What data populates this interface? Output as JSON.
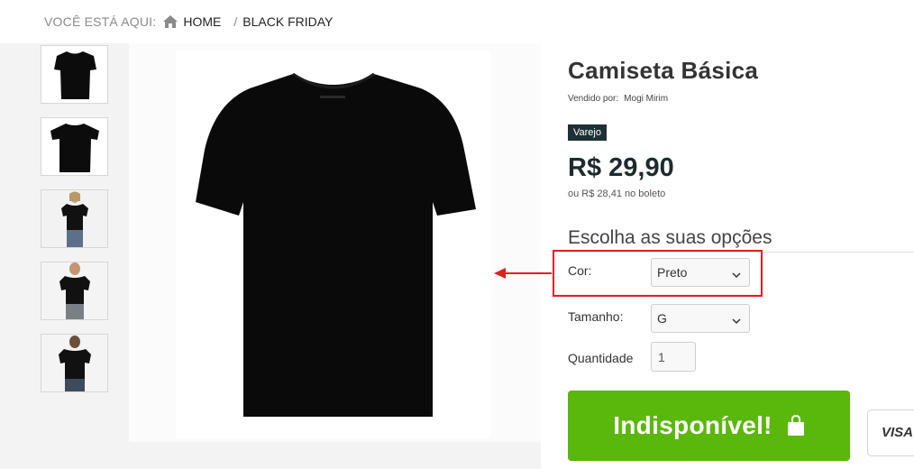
{
  "breadcrumb": {
    "prefix": "VOCÊ ESTÁ AQUI:",
    "home_icon": "home-icon",
    "home": "HOME",
    "separator": "/",
    "current": "BLACK FRIDAY"
  },
  "gallery": {
    "thumbnails": [
      {
        "icon": "black-tshirt-front"
      },
      {
        "icon": "black-tshirt-flat"
      },
      {
        "icon": "woman-wearing-black-tshirt"
      },
      {
        "icon": "man-wearing-black-tshirt"
      },
      {
        "icon": "man-wearing-black-tshirt-back"
      }
    ],
    "main_image": "black-tshirt"
  },
  "product": {
    "title": "Camiseta Básica",
    "seller_label": "Vendido por:",
    "seller": "Mogi Mirim",
    "tag": "Varejo",
    "price": "R$ 29,90",
    "boleto_price": "ou R$ 28,41 no boleto"
  },
  "options": {
    "title": "Escolha as suas opções",
    "color_label": "Cor:",
    "color_value": "Preto",
    "size_label": "Tamanho:",
    "size_value": "G",
    "quantity_label": "Quantidade",
    "quantity_value": "1"
  },
  "actions": {
    "buy_label": "Indisponível!",
    "buy_icon": "shopping-bag-icon",
    "payment_badge": "VISA"
  },
  "annotation": {
    "highlight_color": "#e41c23"
  },
  "colors": {
    "accent_green": "#5ab70c",
    "tag_bg": "#1d3036"
  }
}
